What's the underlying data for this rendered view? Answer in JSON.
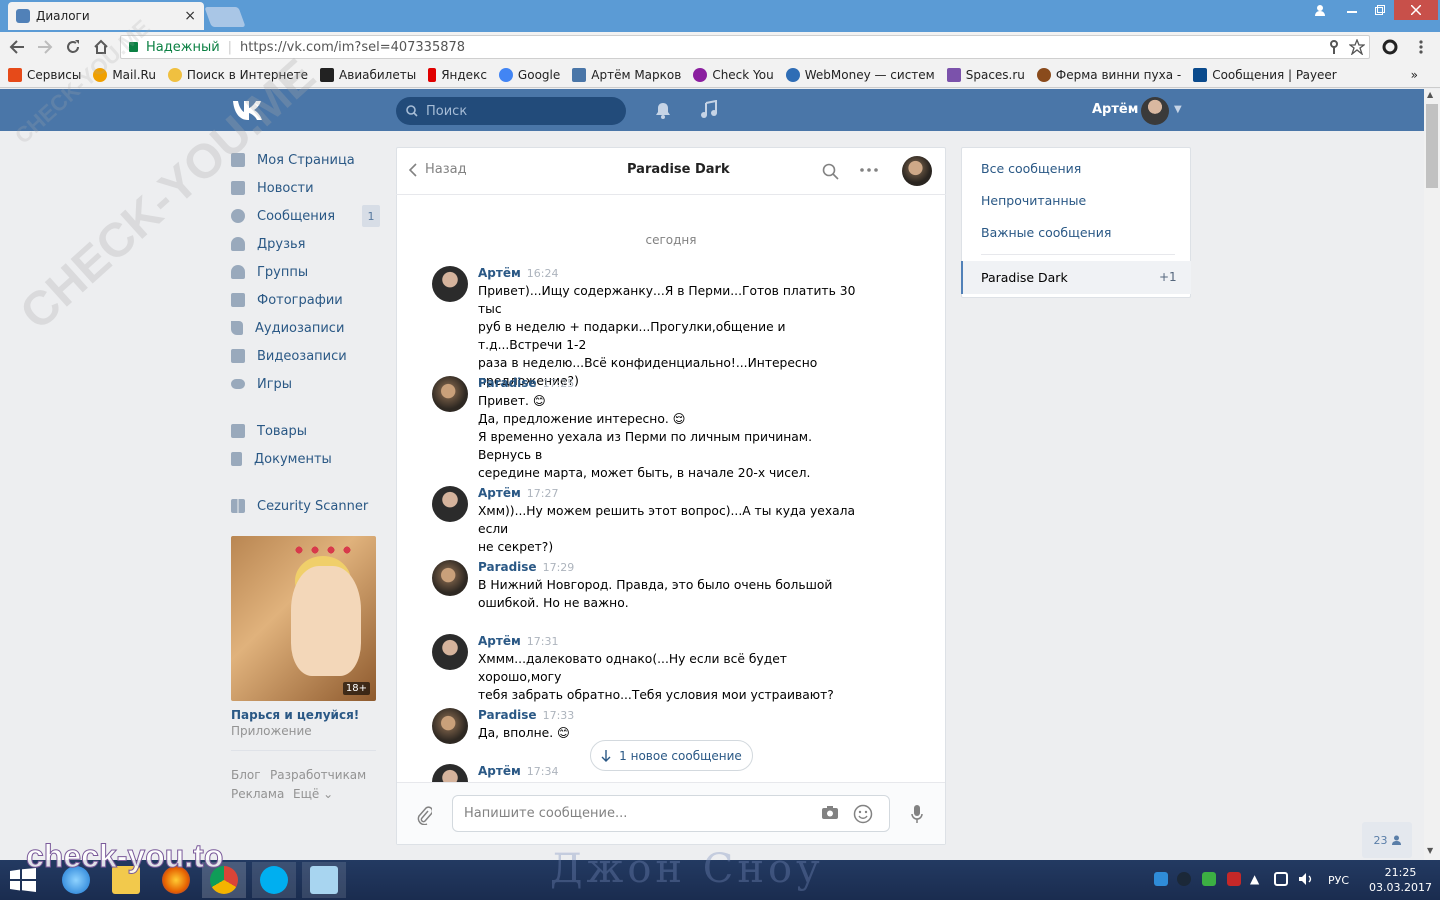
{
  "browser": {
    "tab_title": "Диалоги",
    "tab_close": "×",
    "secure_label": "Надежный",
    "url": "https://vk.com/im?sel=407335878",
    "bookmarks": [
      {
        "label": "Сервисы",
        "color": "#e64a19"
      },
      {
        "label": "Mail.Ru",
        "color": "#f0a000"
      },
      {
        "label": "Поиск в Интернете",
        "color": "#f0c040"
      },
      {
        "label": "Авиабилеты",
        "color": "#222222"
      },
      {
        "label": "Яндекс",
        "color": "#e00000"
      },
      {
        "label": "Google",
        "color": "#4285f4"
      },
      {
        "label": "Артём Марков",
        "color": "#4a76a8"
      },
      {
        "label": "Check You",
        "color": "#8b1fa0"
      },
      {
        "label": "WebMoney — систем",
        "color": "#2f6db5"
      },
      {
        "label": "Spaces.ru",
        "color": "#7b52ab"
      },
      {
        "label": "Ферма винни пуха -",
        "color": "#8a4b1c"
      },
      {
        "label": "Сообщения | Payeer",
        "color": "#0a4a8c"
      }
    ],
    "more_bookmarks": "»"
  },
  "header": {
    "search_placeholder": "Поиск",
    "user_name": "Артём"
  },
  "sidebar": {
    "items": [
      {
        "label": "Моя Страница",
        "icon": "home-icon"
      },
      {
        "label": "Новости",
        "icon": "news-icon"
      },
      {
        "label": "Сообщения",
        "icon": "messages-icon",
        "badge": "1"
      },
      {
        "label": "Друзья",
        "icon": "friends-icon"
      },
      {
        "label": "Группы",
        "icon": "groups-icon"
      },
      {
        "label": "Фотографии",
        "icon": "photos-icon"
      },
      {
        "label": "Аудиозаписи",
        "icon": "audio-icon"
      },
      {
        "label": "Видеозаписи",
        "icon": "video-icon"
      },
      {
        "label": "Игры",
        "icon": "games-icon"
      },
      {
        "label": "Товары",
        "icon": "market-icon"
      },
      {
        "label": "Документы",
        "icon": "docs-icon"
      },
      {
        "label": "Cezurity Scanner",
        "icon": "app-icon"
      }
    ],
    "game": {
      "title": "Парься и целуйся!",
      "subtitle": "Приложение",
      "age": "18+"
    },
    "footer": {
      "blog": "Блог",
      "devs": "Разработчикам",
      "ads": "Реклама",
      "more": "Ещё ⌄"
    }
  },
  "chat": {
    "back_label": "Назад",
    "title": "Paradise Dark",
    "date_divider": "сегодня",
    "messages": [
      {
        "author": "Артём",
        "time": "16:24",
        "text": "Привет)...Ищу содержанку...Я в Перми...Готов платить 30 тыс\nруб в неделю + подарки...Прогулки,общение и т.д...Встречи 1-2\nраза в неделю...Всё конфиденциально!...Интересно\nпредложение?)"
      },
      {
        "author": "Paradise",
        "time": "17:25",
        "text": "Привет. 😊\nДа, предложение интересно. 😌\nЯ временно уехала из Перми по личным причинам. Вернусь в\nсередине марта, может быть, в начале 20-х чисел."
      },
      {
        "author": "Артём",
        "time": "17:27",
        "text": "Хмм))...Ну можем решить этот вопрос)...А ты куда уехала если\nне секрет?)"
      },
      {
        "author": "Paradise",
        "time": "17:29",
        "text": "В Нижний Новгород. Правда, это было очень большой\nошибкой. Но не важно."
      },
      {
        "author": "Артём",
        "time": "17:31",
        "text": "Хммм...далековато однако(...Ну если всё будет хорошо,могу\nтебя забрать обратно...Тебя условия мои устраивают?"
      },
      {
        "author": "Paradise",
        "time": "17:33",
        "text": "Да, вполне. 😊"
      },
      {
        "author": "Артём",
        "time": "17:34",
        "text": ""
      }
    ],
    "new_message_label": "1 новое сообщение",
    "input_placeholder": "Напишите сообщение..."
  },
  "filters": {
    "all": "Все сообщения",
    "unread": "Непрочитанные",
    "important": "Важные сообщения",
    "dialog_name": "Paradise Dark",
    "dialog_count": "+1"
  },
  "online_count": "23",
  "watermarks": {
    "brand": "CHECK-YOU.ME",
    "site": "check-you.to",
    "desktop_text": "Джон Сноу"
  },
  "taskbar": {
    "lang": "РУС",
    "time": "21:25",
    "date": "03.03.2017"
  }
}
